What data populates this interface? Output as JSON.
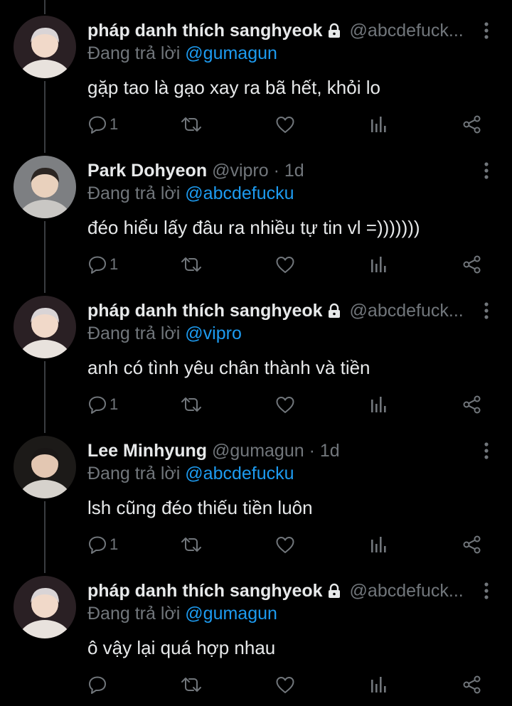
{
  "thread": {
    "tweets": [
      {
        "display_name": "pháp danh thích sanghyeok",
        "protected": true,
        "handle": "@abcdefuck...",
        "time": "",
        "reply_prefix": "Đang trả lời",
        "reply_to": "@gumagun",
        "text": "gặp tao là gạo xay ra bã hết, khỏi lo",
        "reply_count": "1"
      },
      {
        "display_name": "Park Dohyeon",
        "protected": false,
        "handle": "@vipro",
        "time": "1d",
        "reply_prefix": "Đang trả lời",
        "reply_to": "@abcdefucku",
        "text": "đéo hiểu lấy đâu ra nhiều tự tin vl =)))))))",
        "reply_count": "1"
      },
      {
        "display_name": "pháp danh thích sanghyeok",
        "protected": true,
        "handle": "@abcdefuck...",
        "time": "",
        "reply_prefix": "Đang trả lời",
        "reply_to": "@vipro",
        "text": "anh có tình yêu chân thành và tiền",
        "reply_count": "1"
      },
      {
        "display_name": "Lee Minhyung",
        "protected": false,
        "handle": "@gumagun",
        "time": "1d",
        "reply_prefix": "Đang trả lời",
        "reply_to": "@abcdefucku",
        "text": "lsh cũng đéo thiếu tiền luôn",
        "reply_count": "1"
      },
      {
        "display_name": "pháp danh thích sanghyeok",
        "protected": true,
        "handle": "@abcdefuck...",
        "time": "",
        "reply_prefix": "Đang trả lời",
        "reply_to": "@gumagun",
        "text": "ô vậy lại quá hợp nhau",
        "reply_count": ""
      }
    ]
  },
  "icons": {
    "reply": "reply-icon",
    "retweet": "retweet-icon",
    "like": "heart-icon",
    "views": "views-chart-icon",
    "share": "share-icon",
    "more": "more-vertical-icon",
    "lock": "lock-icon"
  },
  "colors": {
    "background": "#000000",
    "primary_text": "#e7e9ea",
    "secondary_text": "#71767b",
    "link": "#1d9bf0",
    "thread_line": "#3a3d41"
  }
}
